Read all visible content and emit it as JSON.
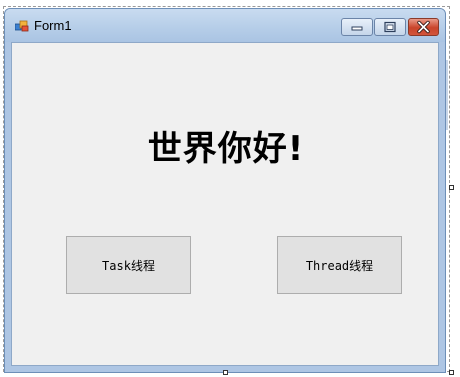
{
  "window": {
    "title": "Form1"
  },
  "form": {
    "heading": "世界你好!",
    "buttons": [
      {
        "label": "Task线程"
      },
      {
        "label": "Thread线程"
      }
    ]
  },
  "colors": {
    "client_background": "#f0f0f0",
    "button_background": "#e1e1e1",
    "close_button": "#c9442a",
    "titlebar": "#b5cde8"
  },
  "icons": {
    "app": "form-app-icon",
    "minimize": "minimize-icon",
    "maximize": "maximize-icon",
    "close": "close-icon"
  }
}
